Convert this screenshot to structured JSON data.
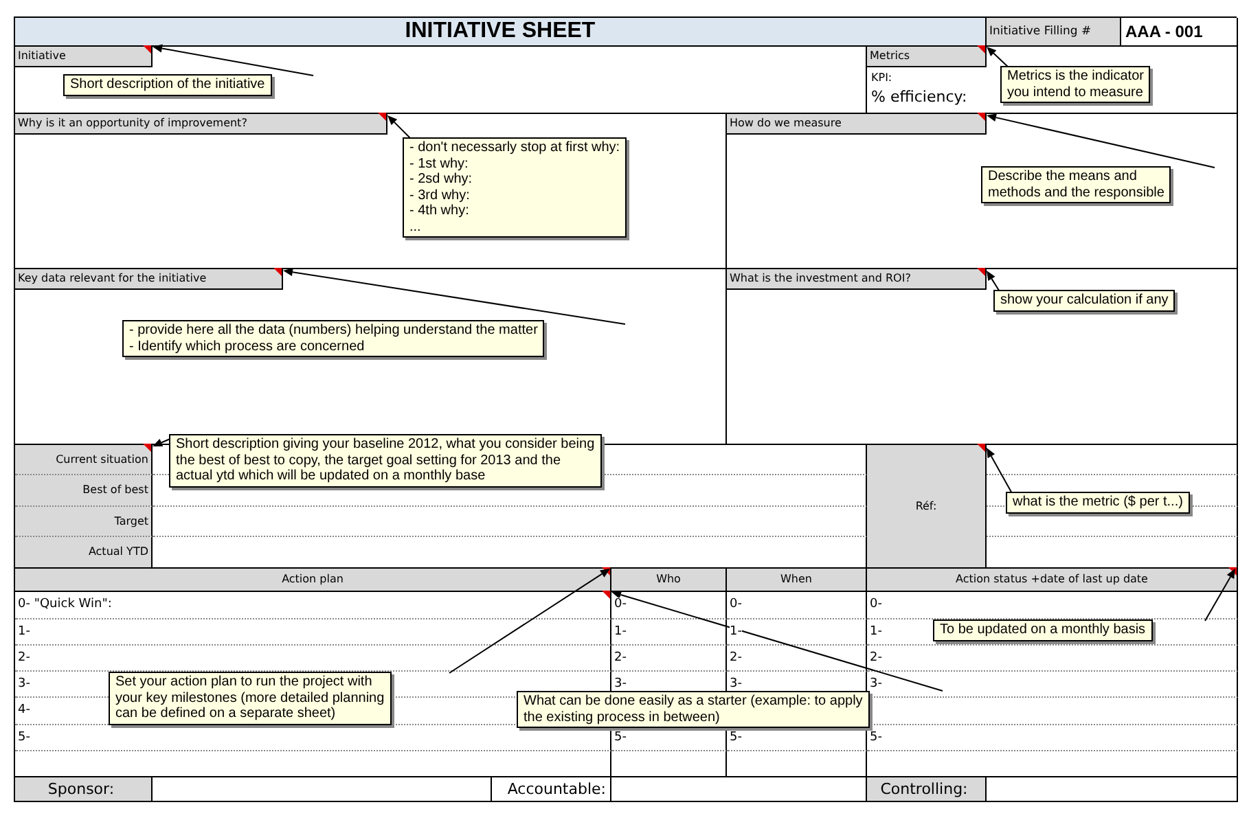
{
  "title": "INITIATIVE SHEET",
  "filling": {
    "label": "Initiative Filling #",
    "number": "AAA - 001"
  },
  "initiative": {
    "header": "Initiative"
  },
  "metrics": {
    "header": "Metrics",
    "lines": [
      "KPI:",
      "% efficiency:"
    ]
  },
  "why": {
    "header": "Why is it an opportunity of improvement?"
  },
  "how": {
    "header": "How do we measure"
  },
  "key_data": {
    "header": "Key data relevant for the initiative"
  },
  "investment": {
    "header": "What is the investment and ROI?"
  },
  "baseline": {
    "rows": [
      "Current situation",
      "Best of best",
      "Target",
      "Actual YTD"
    ],
    "ref_label": "Réf:"
  },
  "action_plan": {
    "columns": [
      "Action plan",
      "Who",
      "When",
      "Action status +date  of last up date"
    ],
    "rows": [
      {
        "plan": "0- \"Quick Win\":",
        "who": "0-",
        "when": "0-",
        "status": "0-"
      },
      {
        "plan": "1-",
        "who": "1-",
        "when": "1-",
        "status": "1-"
      },
      {
        "plan": "2-",
        "who": "2-",
        "when": "2-",
        "status": "2-"
      },
      {
        "plan": "3-",
        "who": "3-",
        "when": "3-",
        "status": "3-"
      },
      {
        "plan": "4-"
      },
      {
        "plan": "5-",
        "who": "5-",
        "when": "5-",
        "status": "5-"
      }
    ]
  },
  "footer": [
    {
      "label": "Sponsor:",
      "shaded": true
    },
    {
      "label": "Accountable:",
      "shaded": false
    },
    {
      "label": "Controlling:",
      "shaded": true
    }
  ],
  "comments": [
    {
      "lines": [
        "Short description of the initiative"
      ]
    },
    {
      "lines": [
        "Metrics is the indicator",
        "you intend to measure"
      ]
    },
    {
      "lines": [
        "- don't necessarly stop at first why:",
        "- 1st why:",
        "- 2sd why:",
        "- 3rd why:",
        "- 4th why:",
        "..."
      ]
    },
    {
      "lines": [
        "Describe the means and",
        "methods and the responsible"
      ]
    },
    {
      "lines": [
        "- provide here all the data (numbers) helping understand the matter",
        "- Identify which process are concerned"
      ]
    },
    {
      "lines": [
        "show your calculation if any"
      ]
    },
    {
      "lines": [
        "Short description giving your baseline 2012, what you consider being",
        "the best of best to copy, the target goal setting for 2013 and the",
        "actual ytd which will be updated on a monthly base"
      ]
    },
    {
      "lines": [
        "what is the metric ($ per t...)"
      ]
    },
    {
      "lines": [
        "Set your action plan to run the project with",
        "your key milestones (more detailed planning",
        "can be defined on a separate sheet)"
      ]
    },
    {
      "lines": [
        "What can be done easily as a starter (example: to apply",
        "the existing process in between)"
      ]
    },
    {
      "lines": [
        "To be updated on a monthly basis"
      ]
    }
  ]
}
